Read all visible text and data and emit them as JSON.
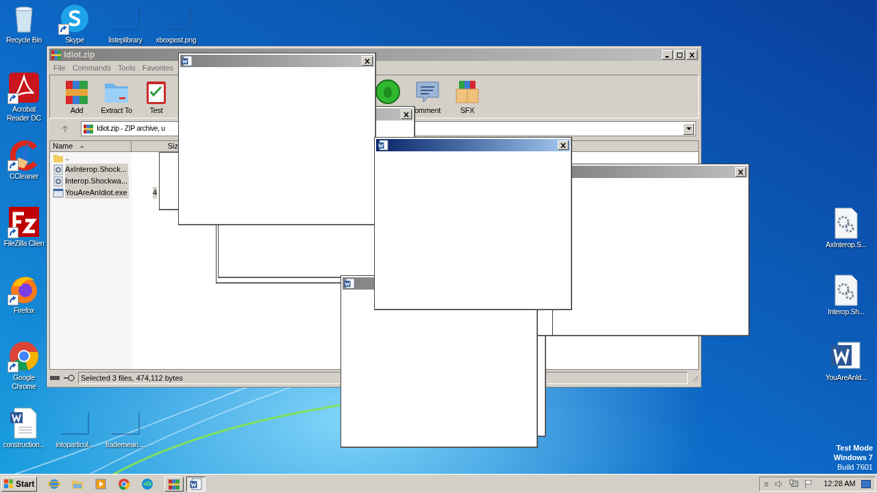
{
  "desktop_icons": [
    {
      "kind": "recycle",
      "label": "Recycle Bin",
      "shortcut": false
    },
    {
      "kind": "skype",
      "label": "Skype",
      "shortcut": true
    },
    {
      "kind": "blank",
      "label": "listeplibrary",
      "shortcut": false
    },
    {
      "kind": "blank",
      "label": "xboxpost.png",
      "shortcut": false
    },
    {
      "kind": "acrobat",
      "label": "Acrobat Reader DC",
      "shortcut": true
    },
    {
      "kind": "ccleaner",
      "label": "CCleaner",
      "shortcut": true
    },
    {
      "kind": "filezilla",
      "label": "FileZilla Clien",
      "shortcut": true
    },
    {
      "kind": "firefox",
      "label": "Firefox",
      "shortcut": true
    },
    {
      "kind": "chrome",
      "label": "Google Chrome",
      "shortcut": true
    },
    {
      "kind": "document",
      "label": "construction...",
      "shortcut": false
    },
    {
      "kind": "blank",
      "label": "intoparticul...",
      "shortcut": false
    },
    {
      "kind": "blank",
      "label": "trademean....",
      "shortcut": false
    },
    {
      "kind": "gear",
      "label": "AxInterop.S...",
      "shortcut": false
    },
    {
      "kind": "gear",
      "label": "Interop.Sh...",
      "shortcut": false
    },
    {
      "kind": "word",
      "label": "YouAreAnId...",
      "shortcut": false
    }
  ],
  "winrar": {
    "title": "Idiot.zip",
    "menu": [
      "File",
      "Commands",
      "Tools",
      "Favorites"
    ],
    "toolbar": [
      {
        "kind": "add",
        "label": "Add"
      },
      {
        "kind": "extract",
        "label": "Extract To"
      },
      {
        "kind": "test",
        "label": "Test"
      },
      {
        "kind": "virus"
      },
      {
        "kind": "comment",
        "label": "omment"
      },
      {
        "kind": "sfx",
        "label": "SFX"
      }
    ],
    "address": "Idiot.zip - ZIP archive, u",
    "columns": [
      "Name",
      "Siz"
    ],
    "rows": [
      {
        "kind": "folder",
        "name": "..",
        "selected": false
      },
      {
        "kind": "gear",
        "name": "AxInterop.Shock...",
        "selected": true
      },
      {
        "kind": "gear",
        "name": "Interop.Shockwa...",
        "selected": true
      },
      {
        "kind": "exe",
        "name": "YouAreAnIdiot.exe",
        "size": "4",
        "selected": true
      }
    ],
    "status": "Selected 3 files, 474,112 bytes"
  },
  "popups": [
    {
      "active": false
    },
    {
      "active": false
    },
    {
      "active": false
    },
    {
      "active": false
    },
    {
      "active": true
    }
  ],
  "os_notice": [
    "Test Mode",
    "Windows 7",
    "Build 7601"
  ],
  "taskbar": {
    "start": "Start",
    "quick_launch": [
      {
        "kind": "ie"
      },
      {
        "kind": "explorer"
      },
      {
        "kind": "media"
      },
      {
        "kind": "chrome"
      },
      {
        "kind": "edge"
      }
    ],
    "tasks": [
      {
        "kind": "winrar",
        "selected": false
      },
      {
        "kind": "word",
        "selected": true
      }
    ],
    "clock": "12:28 AM"
  }
}
